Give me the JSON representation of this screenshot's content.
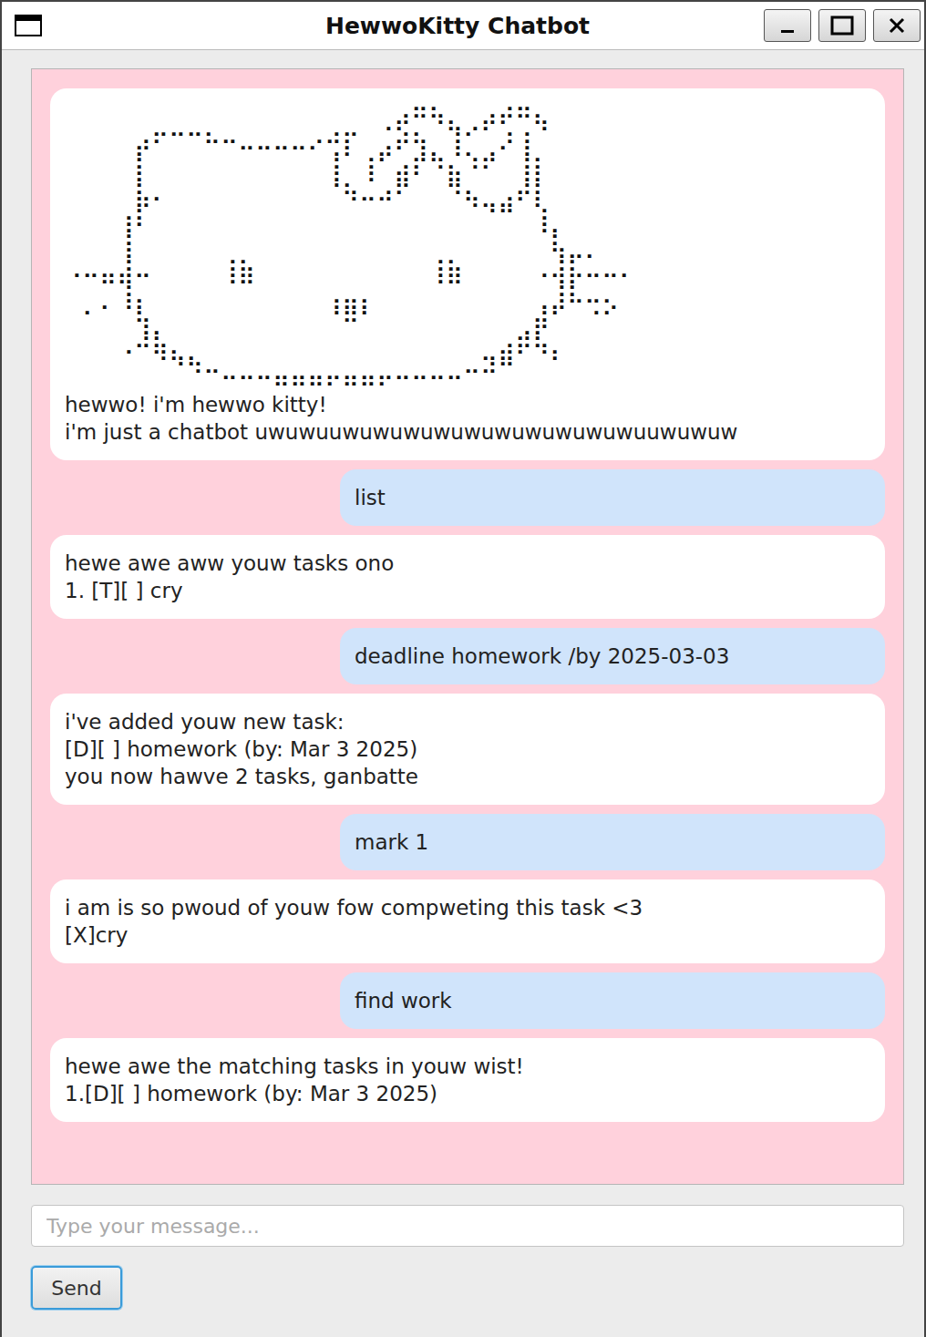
{
  "window": {
    "title": "HewwoKitty Chatbot"
  },
  "messages": [
    {
      "kind": "bot",
      "art": [
        "⠀⠀⠀⠀⠀⠀⠀⠀⠀⠀⠀⠀⠀⠀⠀⠀⠀⠀⢀⡴⠛⠳⣄⢀⡴⠞⠛⢦⠀⠀⠀⠀⠀⠀⠀⠀",
        "⠀⠀⠀⠀⡴⠋⠉⠉⠓⠒⠤⠤⠤⠤⠔⢚⡏⠀⣠⠞⢳⡀⢸⡁⢀⠜⢸⠀⠀⠀⠀⠀⠀⠀⠀⠀",
        "⠀⠀⠀⠀⡇⠀⠀⠀⠀⠀⠀⠀⠀⠀⠀⢸⠀⢸⠁⣴⠏⠙⣦⠘⠋⠀⢸⡇⠀⠀⠀⠀⠀⠀⠀⠀",
        "⠀⠀⠀⠀⣧⠄⠀⠀⠀⠀⠀⠀⠀⠀⠀⠈⠳⠤⠴⠋⠀⠀⠙⢦⣀⣠⠞⡇⠀⠀⠀⠀⠀⠀⠀⠀",
        "⠀⠀⠀⢰⠇⠀⠀⠀⠀⠀⠀⠀⠀⠀⠀⠀⠀⠀⠀⠀⠀⠀⠀⠀⠈⠉⠀⢸⡀⠀⠀⠀⠀⠀⠀⠀",
        "⠀⠀⠀⢸⠀⠀⠀⠀⠀⠀⠀⠀⠀⠀⠀⠀⠀⠀⠀⠀⠀⠀⠀⠀⠀⠀⠀⠀⢧⣀⡀⠀⠀⠀⠀⠀",
        "⠠⠤⣤⣼⠤⠀⠀⠀⠀⢸⣷⠀⠀⠀⠀⠀⠀⠀⠀⠀⠀⢸⣷⠀⠀⠀⠀⠠⢼⡧⠤⠤⠄⠀⠀⠀⠀⠀",
        "⠀⠀⡀⢸⡄⠀⠀⠀⠀⠀⠀⠀⠀⠀⠀⢠⣤⡄⠀⠀⠀⠀⠀⠀⠀⠀⠀⢀⣸⠧⠤⢄⠀⠀⠀⠀⠀⠀",
        "⠀⠁⠀⠀⢳⡀⠀⠀⠀⠀⠀⠀⠀⠀⠀⠈⠛⠁⠀⠀⠀⠀⠀⠀⠀⠀⢀⡾⠁⠀⠈⠁⠀⠀⠀⠀⠀⠀",
        "⠀⠀⠀⠠⠚⢷⣄⡀⠀⠀⠀⠀⠀⠀⠀⠀⠀⠀⠀⠀⠀⠀⠀⠀⣀⣴⠟⠳⡄⠀⠀⠀⠀⠀⠀⠀⠀⠀",
        "⠀⠀⠀⠀⠀⠀⠈⠙⠒⠤⠤⠤⣤⣤⣤⡤⣤⣤⡤⠤⠤⠤⠤⠒⠚⠉⠀⠀⠀⠀⠀⠀⠀⠀⠀⠀⠀⠀"
      ],
      "lines": [
        "hewwo! i'm hewwo kitty!",
        "i'm just a chatbot uwuwuuwuwuwuwuwuwuwuwuwuwuuwuwuw"
      ]
    },
    {
      "kind": "user",
      "art": [],
      "lines": [
        "list"
      ]
    },
    {
      "kind": "bot",
      "art": [],
      "lines": [
        "hewe awe aww youw tasks ono",
        "1. [T][ ] cry"
      ]
    },
    {
      "kind": "user",
      "art": [],
      "lines": [
        "deadline homework /by 2025-03-03"
      ]
    },
    {
      "kind": "bot",
      "art": [],
      "lines": [
        "i've added youw new task:",
        "[D][ ] homework (by: Mar 3 2025)",
        "you now hawve 2 tasks, ganbatte"
      ]
    },
    {
      "kind": "user",
      "art": [],
      "lines": [
        "mark 1"
      ]
    },
    {
      "kind": "bot",
      "art": [],
      "lines": [
        "i am is so pwoud of youw fow compweting this task <3",
        "[X]cry"
      ]
    },
    {
      "kind": "user",
      "art": [],
      "lines": [
        "find work"
      ]
    },
    {
      "kind": "bot",
      "art": [],
      "lines": [
        "hewe awe the matching tasks in youw wist!",
        "1.[D][ ] homework (by: Mar 3 2025)"
      ]
    }
  ],
  "input": {
    "placeholder": "Type your message...",
    "value": ""
  },
  "send_button": {
    "label": "Send",
    "focused": true
  }
}
